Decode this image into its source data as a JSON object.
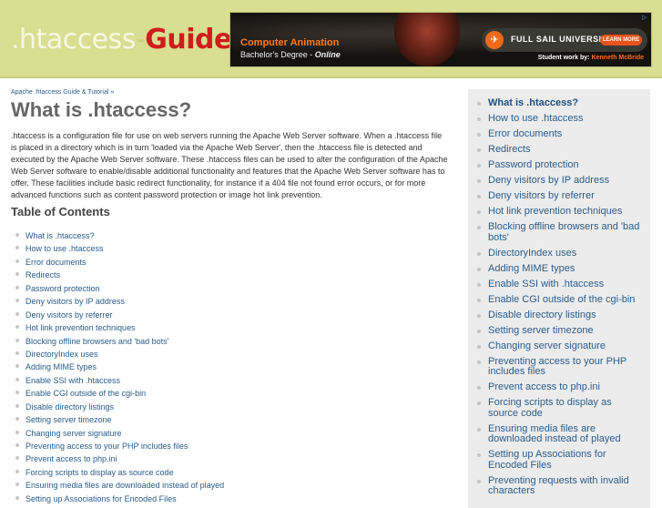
{
  "header": {
    "logo": {
      "part1": ".htaccess",
      "sep": "-",
      "part2": "Guide"
    },
    "ad": {
      "headline": "Computer Animation",
      "subline": "Bachelor's Degree - ",
      "subline_em": "Online",
      "brand": "FULL SAIL UNIVERSITY.",
      "cta": "LEARN MORE",
      "credit_label": "Student work by: ",
      "credit_name": "Kenneth McBride",
      "icons": {
        "plane": "airplane-icon",
        "adchoices": "adchoices-icon"
      }
    }
  },
  "main": {
    "breadcrumb": "Apache .htaccess Guide & Tutorial »",
    "title": "What is .htaccess?",
    "intro": ".htaccess is a configuration file for use on web servers running the Apache Web Server software. When a .htaccess file is placed in a directory which is in turn 'loaded via the Apache Web Server', then the .htaccess file is detected and executed by the Apache Web Server software. These .htaccess files can be used to alter the configuration of the Apache Web Server software to enable/disable additional functionality and features that the Apache Web Server software has to offer. These facilities include basic redirect functionality, for instance if a 404 file not found error occurs, or for more advanced functions such as content password protection or image hot link prevention.",
    "toc_title": "Table of Contents",
    "toc": [
      "What is .htaccess?",
      "How to use .htaccess",
      "Error documents",
      "Redirects",
      "Password protection",
      "Deny visitors by IP address",
      "Deny visitors by referrer",
      "Hot link prevention techniques",
      "Blocking offline browsers and 'bad bots'",
      "DirectoryIndex uses",
      "Adding MIME types",
      "Enable SSI with .htaccess",
      "Enable CGI outside of the cgi-bin",
      "Disable directory listings",
      "Setting server timezone",
      "Changing server signature",
      "Preventing access to your PHP includes files",
      "Prevent access to php.ini",
      "Forcing scripts to display as source code",
      "Ensuring media files are downloaded instead of played",
      "Setting up Associations for Encoded Files"
    ]
  },
  "sidebar": {
    "active_index": 0,
    "items": [
      "What is .htaccess?",
      "How to use .htaccess",
      "Error documents",
      "Redirects",
      "Password protection",
      "Deny visitors by IP address",
      "Deny visitors by referrer",
      "Hot link prevention techniques",
      "Blocking offline browsers and 'bad bots'",
      "DirectoryIndex uses",
      "Adding MIME types",
      "Enable SSI with .htaccess",
      "Enable CGI outside of the cgi-bin",
      "Disable directory listings",
      "Setting server timezone",
      "Changing server signature",
      "Preventing access to your PHP includes files",
      "Prevent access to php.ini",
      "Forcing scripts to display as source code",
      "Ensuring media files are downloaded instead of played",
      "Setting up Associations for Encoded Files",
      "Preventing requests with invalid characters"
    ]
  },
  "colors": {
    "header_bg": "#d9de90",
    "logo_accent": "#d01c1c",
    "link": "#2a5c8a",
    "sidebar_bg": "#ececec",
    "title": "#666666"
  }
}
